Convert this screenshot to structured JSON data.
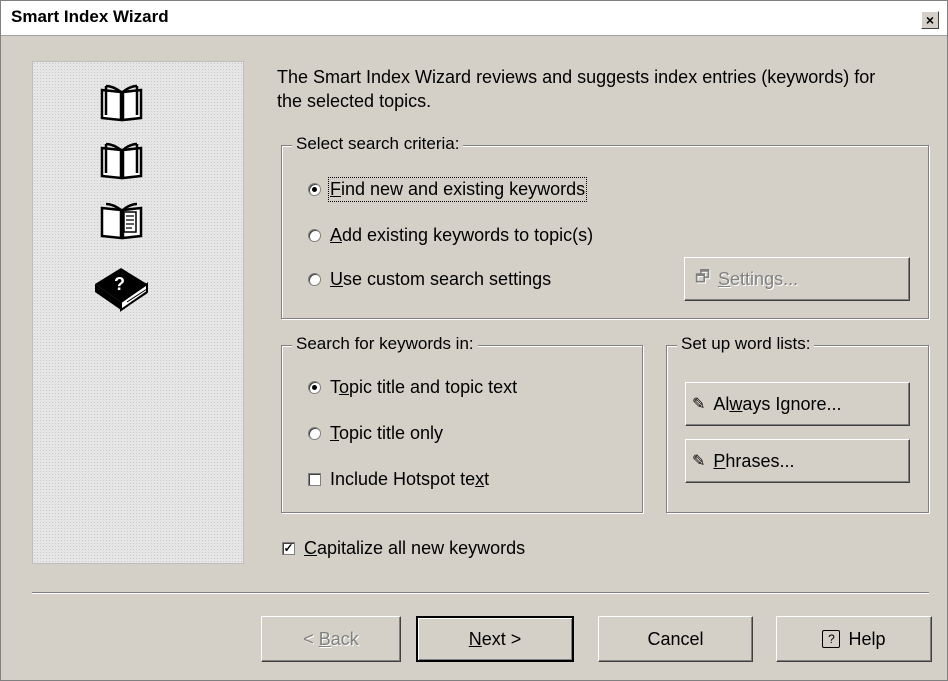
{
  "window": {
    "title": "Smart Index Wizard",
    "close_label": "×"
  },
  "intro": "The Smart Index Wizard reviews and suggests index entries (keywords) for the selected topics.",
  "side_icons": [
    "open-book-icon",
    "open-book-icon",
    "book-page-icon",
    "help-book-icon"
  ],
  "criteria": {
    "label": "Select search criteria:",
    "options": [
      {
        "accel": "F",
        "rest": "ind new and existing keywords",
        "selected": true
      },
      {
        "accel": "A",
        "rest": "dd existing keywords to topic(s)",
        "selected": false
      },
      {
        "accel": "U",
        "rest": "se custom search settings",
        "selected": false
      }
    ],
    "settings_button": {
      "accel": "S",
      "rest": "ettings...",
      "enabled": false
    }
  },
  "search_in": {
    "label": "Search for keywords in:",
    "options": [
      {
        "pre": "T",
        "accel": "o",
        "rest": "pic title and topic text",
        "selected": true
      },
      {
        "pre": "",
        "accel": "T",
        "rest": "opic title only",
        "selected": false
      }
    ],
    "hotspot": {
      "pre": "Include Hotspot te",
      "accel": "x",
      "rest": "t",
      "checked": false
    }
  },
  "word_lists": {
    "label": "Set up word lists:",
    "always_ignore": {
      "pre": "Al",
      "accel": "w",
      "rest": "ays Ignore..."
    },
    "phrases": {
      "pre": "",
      "accel": "P",
      "rest": "hrases..."
    }
  },
  "capitalize": {
    "accel": "C",
    "rest": "apitalize all new keywords",
    "checked": true
  },
  "footer": {
    "back": {
      "pre": "< ",
      "accel": "B",
      "rest": "ack",
      "enabled": false
    },
    "next": {
      "accel": "N",
      "rest": "ext >"
    },
    "cancel": "Cancel",
    "help": "Help"
  }
}
